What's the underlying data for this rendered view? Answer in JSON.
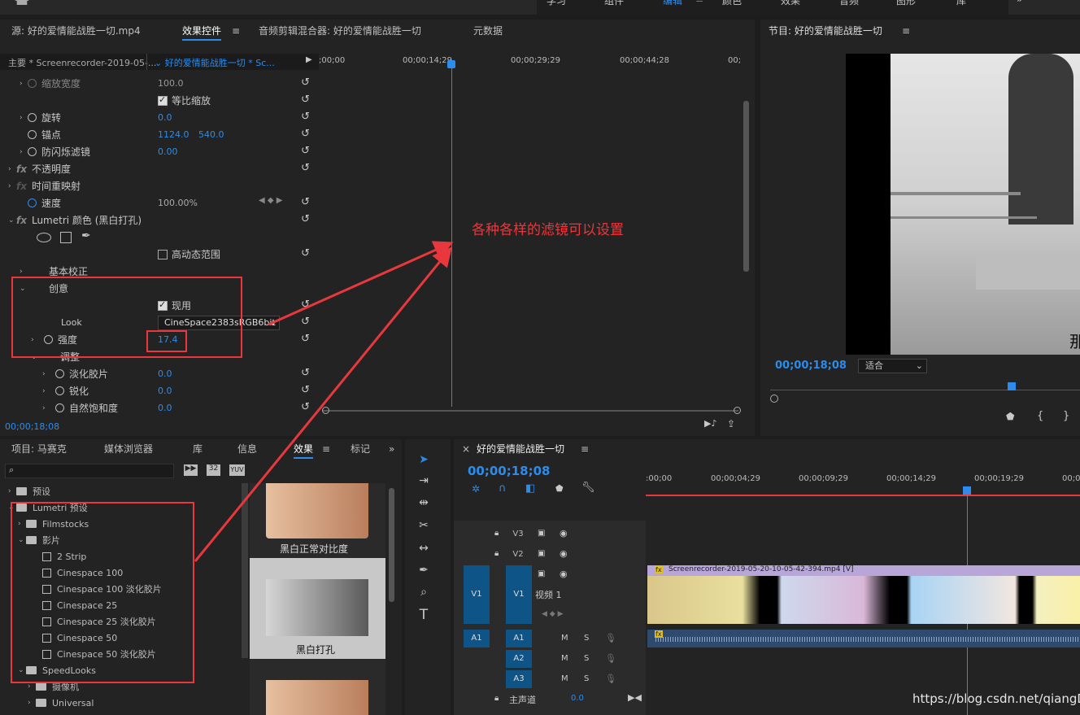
{
  "top_tabs": [
    "学习",
    "组件",
    "编辑",
    "颜色",
    "效果",
    "音频",
    "图形",
    "库"
  ],
  "top_more": "»",
  "src_tabs": {
    "source": "源: 好的爱情能战胜一切.mp4",
    "effect_controls": "效果控件",
    "mixer": "音频剪辑混合器: 好的爱情能战胜一切",
    "metadata": "元数据"
  },
  "ec": {
    "master": "主要 * Screenrecorder-2019-05-...",
    "clip": "好的爱情能战胜一切 * Sc...",
    "ruler": [
      ";00;00",
      "00;00;14;29",
      "00;00;29;29",
      "00;00;44;28",
      "00;"
    ],
    "rows": {
      "scale_w": {
        "label": "缩放宽度",
        "value": "100.0"
      },
      "uniform": "等比缩放",
      "rotate": {
        "label": "旋转",
        "value": "0.0"
      },
      "anchor": {
        "label": "锚点",
        "v1": "1124.0",
        "v2": "540.0"
      },
      "flicker": {
        "label": "防闪烁滤镜",
        "value": "0.00"
      },
      "opacity": "不透明度",
      "timeremap": "时间重映射",
      "speed": {
        "label": "速度",
        "value": "100.00%"
      },
      "lumetri": "Lumetri 颜色 (黑白打孔)",
      "hdr": "高动态范围",
      "basic": "基本校正",
      "creative": "创意",
      "enabled": "现用",
      "look": {
        "label": "Look",
        "value": "CineSpace2383sRGB6bit"
      },
      "intensity": {
        "label": "强度",
        "value": "17.4"
      },
      "adjust": "调整",
      "faded": {
        "label": "淡化胶片",
        "value": "0.0"
      },
      "sharpen": {
        "label": "锐化",
        "value": "0.0"
      },
      "vibrance": {
        "label": "自然饱和度",
        "value": "0.0"
      }
    },
    "timecode": "00;00;18;08"
  },
  "annotation": "各种各样的滤镜可以设置",
  "program": {
    "title": "节目: 好的爱情能战胜一切",
    "timecode": "00;00;18;08",
    "fit": "适合",
    "subtitle": "那"
  },
  "project": {
    "tabs": [
      "项目: 马赛克",
      "媒体浏览器",
      "库",
      "信息",
      "效果",
      "标记"
    ],
    "badges": [
      "32",
      "YUV"
    ],
    "tree": [
      "预设",
      "Lumetri 预设",
      "Filmstocks",
      "影片",
      "2 Strip",
      "Cinespace 100",
      "Cinespace 100 淡化胶片",
      "Cinespace 25",
      "Cinespace 25 淡化胶片",
      "Cinespace 50",
      "Cinespace 50 淡化胶片",
      "SpeedLooks",
      "摄像机",
      "Universal"
    ],
    "thumbs": [
      "黑白正常对比度",
      "黑白打孔"
    ]
  },
  "timeline": {
    "title": "好的爱情能战胜一切",
    "timecode": "00;00;18;08",
    "ruler": [
      ":00;00",
      "00;00;04;29",
      "00;00;09;29",
      "00;00;14;29",
      "00;00;19;29",
      "00;00;"
    ],
    "v_tracks": [
      "V3",
      "V2",
      "V1"
    ],
    "a_tracks": [
      "A1",
      "A2",
      "A3"
    ],
    "src_v": "V1",
    "src_a": "A1",
    "video1": "视频 1",
    "master": "主声道",
    "master_val": "0.0",
    "clip": "Screenrecorder-2019-05-20-10-05-42-394.mp4 [V]",
    "fx": "fx",
    "m": "M",
    "s": "S"
  },
  "watermark": "https://blog.csdn.net/qiangD",
  "colors": {
    "accent": "#2d8ceb",
    "red": "#e8383d",
    "panel": "#232323"
  }
}
